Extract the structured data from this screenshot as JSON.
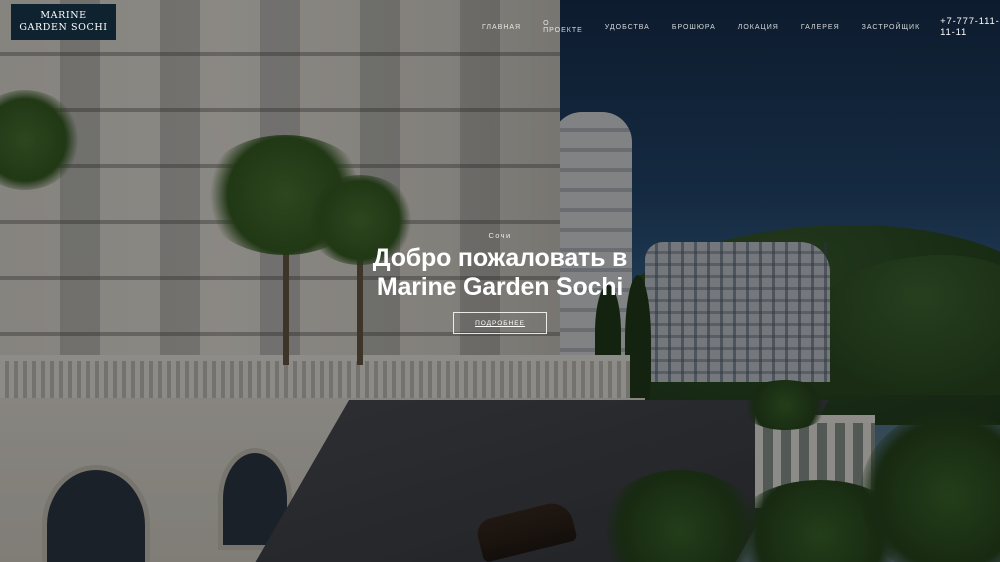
{
  "header": {
    "logo_line1": "MARINE",
    "logo_line2": "GARDEN SOCHI",
    "nav": [
      "ГЛАВНАЯ",
      "О ПРОЕКТЕ",
      "УДОБСТВА",
      "БРОШЮРА",
      "ЛОКАЦИЯ",
      "ГАЛЕРЕЯ",
      "ЗАСТРОЙЩИК"
    ],
    "phone": "+7-777-111-11-11"
  },
  "hero": {
    "eyebrow": "Сочи",
    "title_line1": "Добро пожаловать в",
    "title_line2": "Marine Garden Sochi",
    "button_label": "ПОДРОБНЕЕ"
  },
  "colors": {
    "logo_background": "#0f2230",
    "overlay": "rgba(0,0,0,0.42)",
    "text": "#ffffff"
  }
}
